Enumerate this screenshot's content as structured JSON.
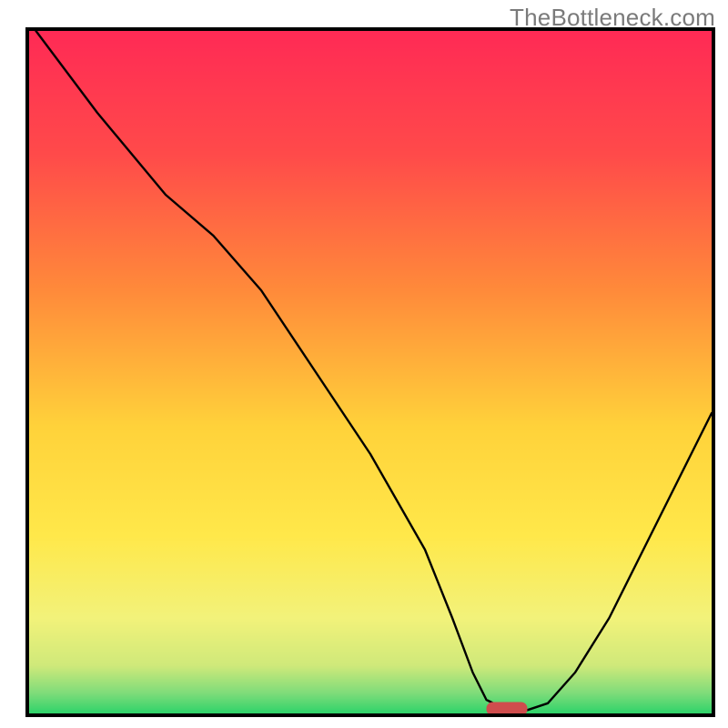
{
  "watermark": "TheBottleneck.com",
  "chart_data": {
    "type": "line",
    "title": "",
    "xlabel": "",
    "ylabel": "",
    "xlim": [
      0,
      100
    ],
    "ylim": [
      0,
      100
    ],
    "grid": false,
    "gradient_stops": [
      {
        "offset": 0,
        "color": "#ff2a55"
      },
      {
        "offset": 18,
        "color": "#ff4a4a"
      },
      {
        "offset": 38,
        "color": "#ff8a3a"
      },
      {
        "offset": 58,
        "color": "#ffd23a"
      },
      {
        "offset": 74,
        "color": "#ffe84a"
      },
      {
        "offset": 86,
        "color": "#f2f27a"
      },
      {
        "offset": 93,
        "color": "#cfe97a"
      },
      {
        "offset": 97,
        "color": "#7fdc7a"
      },
      {
        "offset": 100,
        "color": "#2ed36a"
      }
    ],
    "series": [
      {
        "name": "bottleneck_curve",
        "x": [
          1,
          10,
          20,
          27,
          34,
          42,
          50,
          58,
          62,
          65,
          67,
          70,
          73,
          76,
          80,
          85,
          90,
          95,
          100
        ],
        "y": [
          100,
          88,
          76,
          70,
          62,
          50,
          38,
          24,
          14,
          6,
          2,
          0.5,
          0.5,
          1.5,
          6,
          14,
          24,
          34,
          44
        ]
      }
    ],
    "optimum_region": {
      "x_start": 67,
      "x_end": 73,
      "y": 0.6
    }
  }
}
